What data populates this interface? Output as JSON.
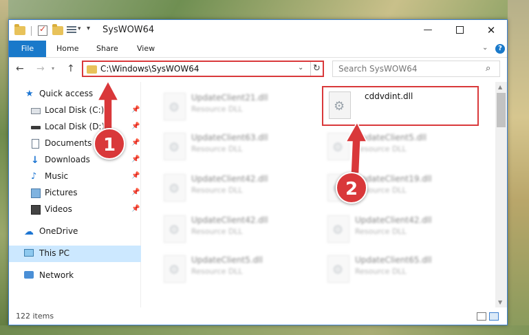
{
  "window": {
    "title": "SysWOW64",
    "minimize_glyph": "—",
    "close_glyph": "✕"
  },
  "ribbon": {
    "tabs": [
      "File",
      "Home",
      "Share",
      "View"
    ],
    "help_glyph": "?"
  },
  "address": {
    "path": "C:\\Windows\\SysWOW64",
    "search_placeholder": "Search SysWOW64"
  },
  "nav_pane": {
    "items": [
      {
        "label": "Quick access",
        "icon": "star-icon"
      },
      {
        "label": "Local Disk (C:)",
        "icon": "drive-icon",
        "pinned": true
      },
      {
        "label": "Local Disk (D:)",
        "icon": "drive-icon",
        "pinned": true
      },
      {
        "label": "Documents",
        "icon": "document-icon",
        "pinned": true
      },
      {
        "label": "Downloads",
        "icon": "download-icon",
        "pinned": true
      },
      {
        "label": "Music",
        "icon": "music-icon",
        "pinned": true
      },
      {
        "label": "Pictures",
        "icon": "pictures-icon",
        "pinned": true
      },
      {
        "label": "Videos",
        "icon": "videos-icon",
        "pinned": true
      },
      {
        "label": "OneDrive",
        "icon": "cloud-icon"
      },
      {
        "label": "This PC",
        "icon": "computer-icon",
        "selected": true
      },
      {
        "label": "Network",
        "icon": "network-icon"
      }
    ]
  },
  "files": {
    "left_column": [
      {
        "name": "UpdateClient21.dll",
        "type": "Resource DLL"
      },
      {
        "name": "UpdateClient63.dll",
        "type": "Resource DLL"
      },
      {
        "name": "UpdateClient42.dll",
        "type": "Resource DLL"
      },
      {
        "name": "UpdateClient42.dll",
        "type": "Resource DLL"
      },
      {
        "name": "UpdateClient5.dll",
        "type": "Resource DLL"
      }
    ],
    "right_column": [
      {
        "name": "cddvdint.dll",
        "type": ""
      },
      {
        "name": "UpdateClient5.dll",
        "type": "Resource DLL"
      },
      {
        "name": "UpdateClient19.dll",
        "type": "Resource DLL"
      },
      {
        "name": "UpdateClient42.dll",
        "type": "Resource DLL"
      },
      {
        "name": "UpdateClient65.dll",
        "type": "Resource DLL"
      }
    ]
  },
  "status": {
    "item_count": "122 items"
  },
  "annotations": {
    "marker1": "1",
    "marker2": "2",
    "highlight_color": "#d9383a"
  },
  "colors": {
    "accent": "#1979ca",
    "selection": "#cce8ff",
    "annotation_red": "#d9383a"
  }
}
